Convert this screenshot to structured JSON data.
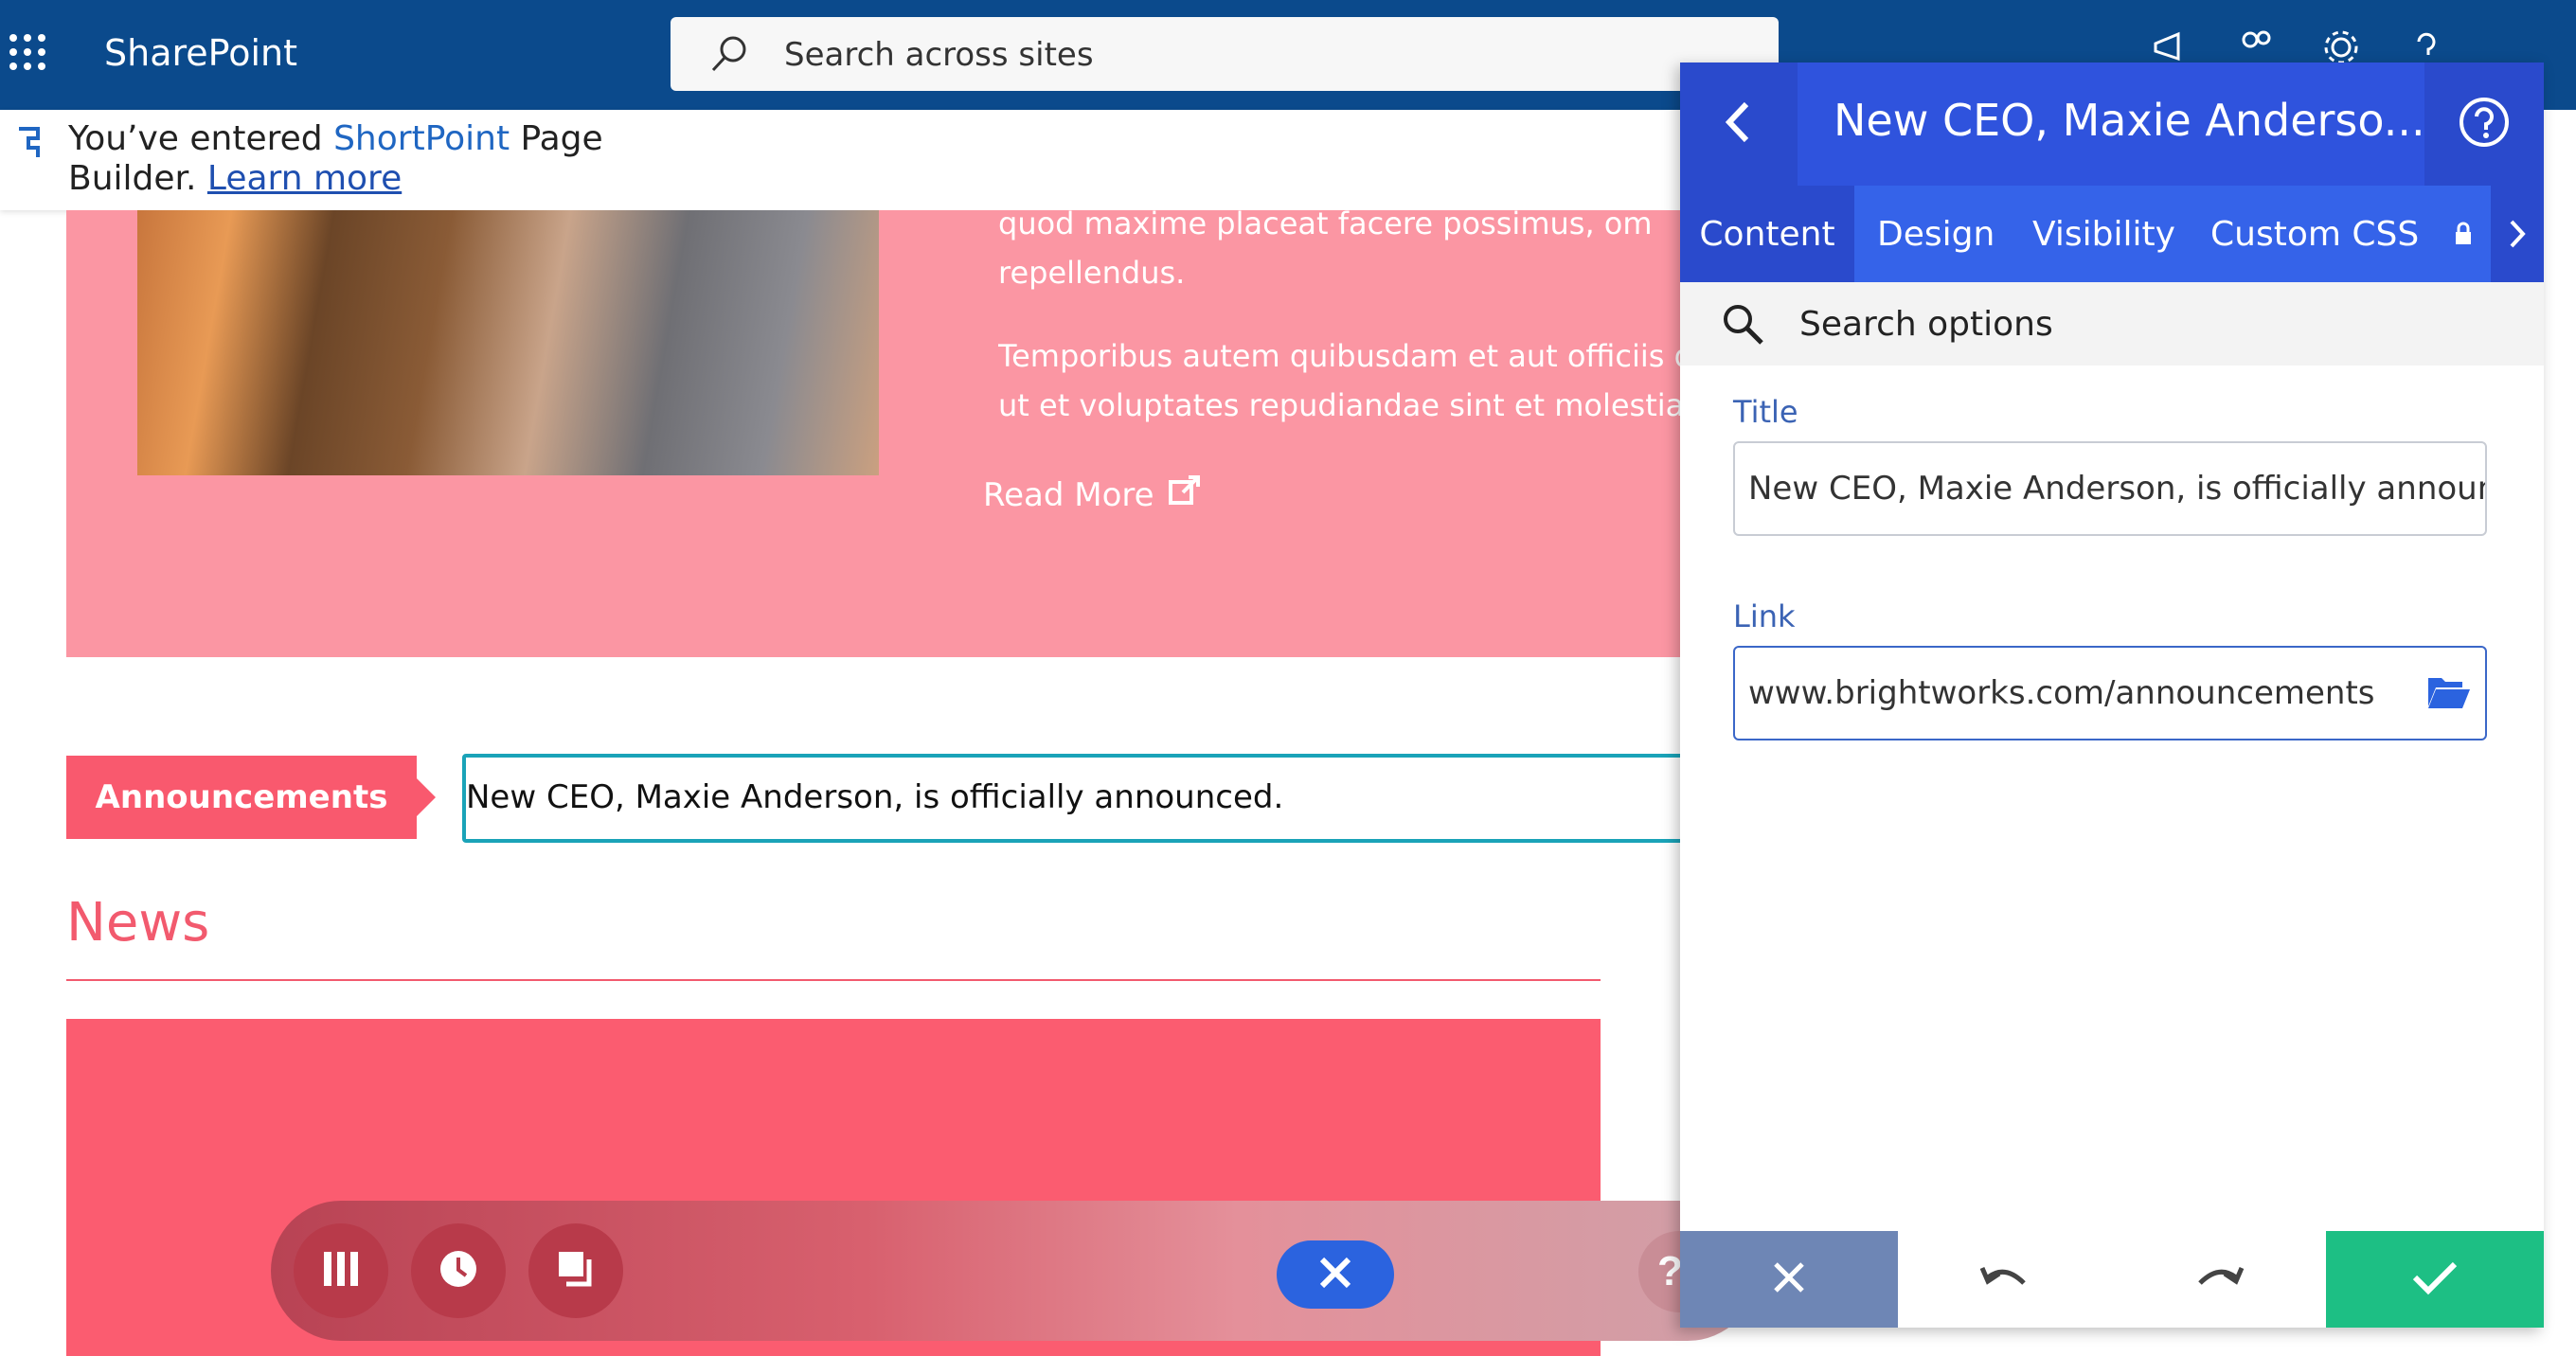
{
  "topbar": {
    "app_name": "SharePoint",
    "search_placeholder": "Search across sites"
  },
  "notice": {
    "prefix": "You’ve entered ",
    "brand": "ShortPoint",
    "suffix": " Page Builder. ",
    "link": "Learn more"
  },
  "hero": {
    "para1_line1": "quod maxime placeat facere possimus, om",
    "para1_line2": "repellendus.",
    "para2_line1": "Temporibus autem quibusdam et aut officiis d",
    "para2_line2": "ut et voluptates repudiandae sint et molestiae n",
    "read_more": "Read More"
  },
  "ticker": {
    "label": "Announcements",
    "text": "New CEO, Maxie Anderson, is officially announced."
  },
  "news": {
    "title": "News"
  },
  "panel": {
    "title": "New CEO, Maxie Anderso...",
    "tabs": [
      "Content",
      "Design",
      "Visibility",
      "Custom CSS"
    ],
    "active_tab": "Content",
    "search_placeholder": "Search options",
    "title_label": "Title",
    "title_value": "New CEO, Maxie Anderson, is officially announced.",
    "link_label": "Link",
    "link_value": "www.brightworks.com/announcements"
  },
  "colors": {
    "suite_bar": "#0b4a8c",
    "panel_header": "#2f53dd",
    "accent_pink": "#f9596e",
    "confirm_green": "#1dbf84"
  }
}
